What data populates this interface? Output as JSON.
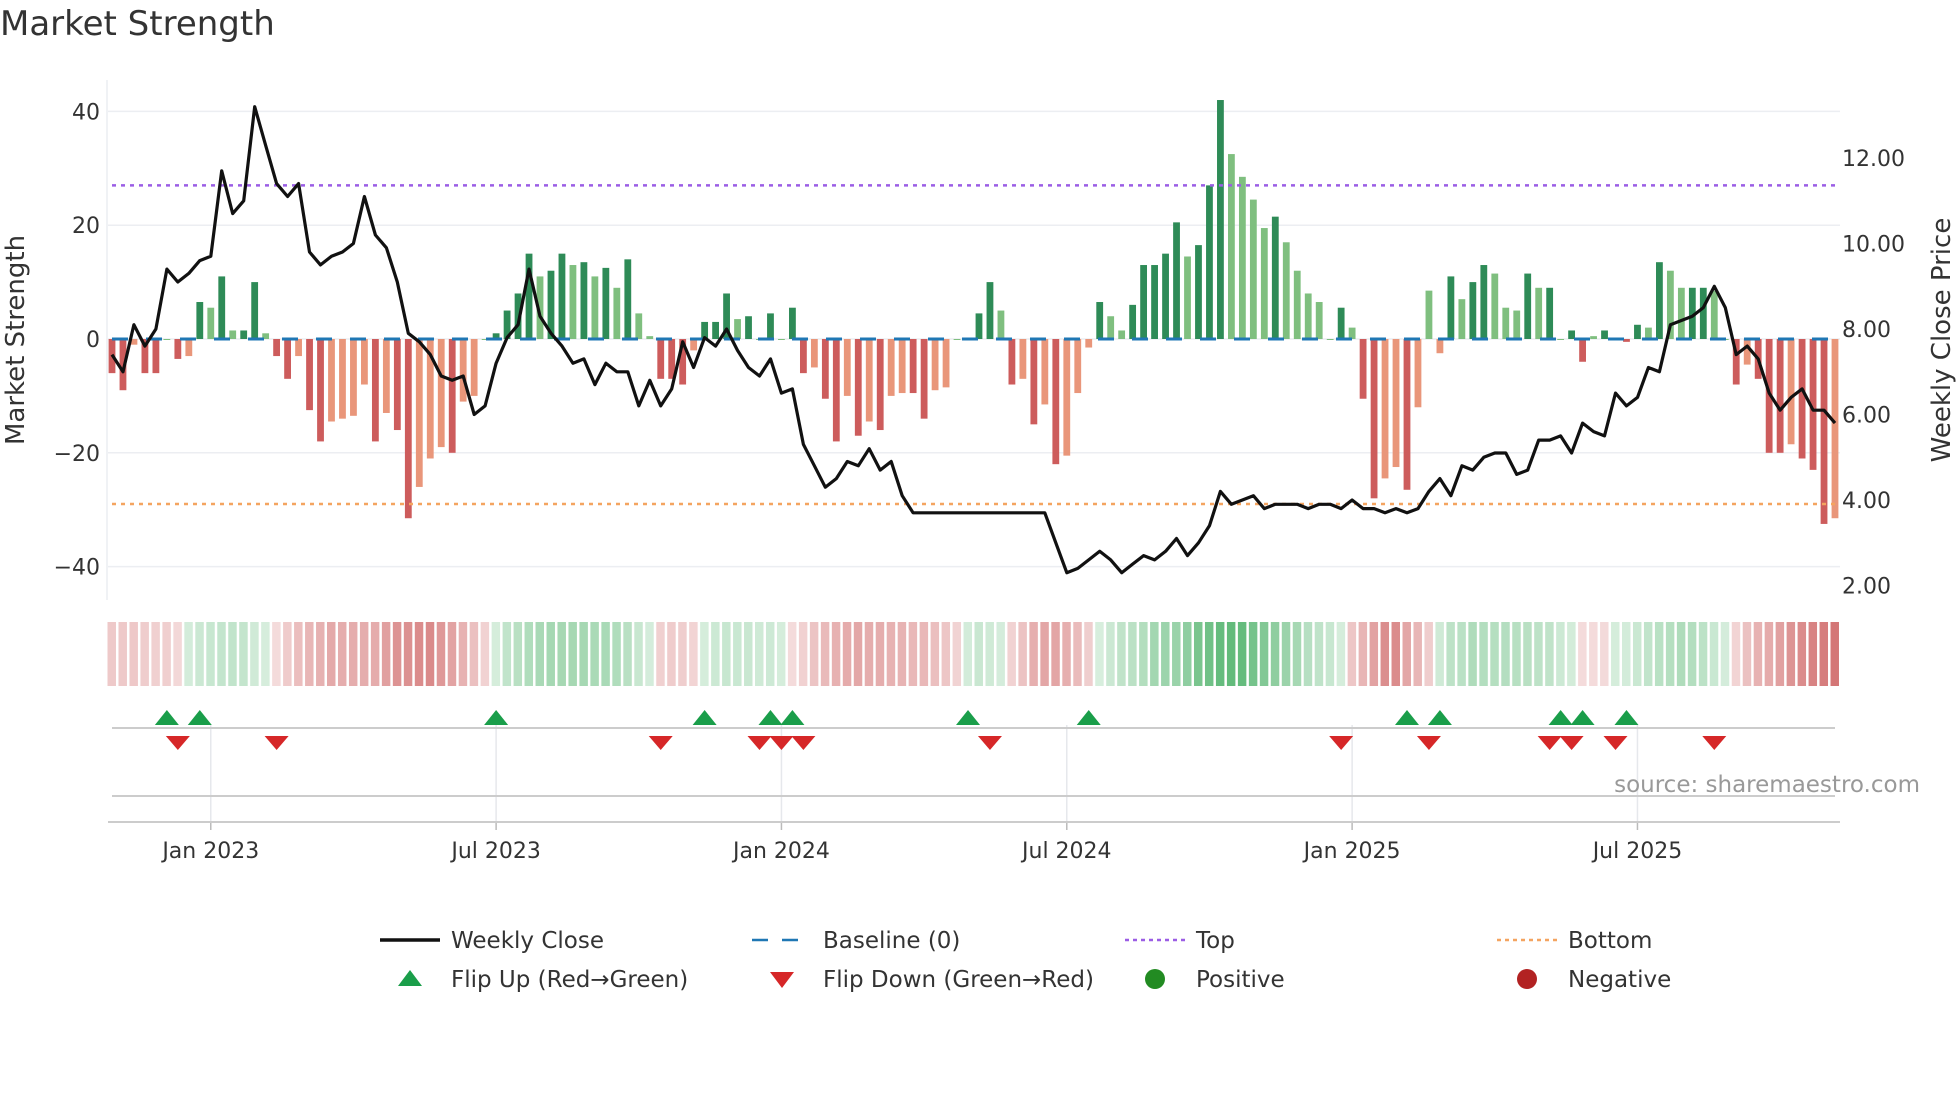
{
  "chart_data": {
    "type": "bar+line",
    "title": "Market Strength",
    "ylabel_left": "Market Strength",
    "ylabel_right": "Weekly Close Price",
    "ylim_left": [
      -42,
      45
    ],
    "ylim_right": [
      1.8,
      13.6
    ],
    "left_ticks": [
      {
        "v": 40,
        "label": "40"
      },
      {
        "v": 20,
        "label": "20"
      },
      {
        "v": 0,
        "label": "0"
      },
      {
        "v": -20,
        "label": "−20"
      },
      {
        "v": -40,
        "label": "−40"
      }
    ],
    "right_ticks": [
      {
        "v": 12,
        "label": "12.00"
      },
      {
        "v": 10,
        "label": "10.00"
      },
      {
        "v": 8,
        "label": "8.00"
      },
      {
        "v": 6,
        "label": "6.00"
      },
      {
        "v": 4,
        "label": "4.00"
      },
      {
        "v": 2,
        "label": "2.00"
      }
    ],
    "x_ticks": [
      {
        "week": 9,
        "label": "Jan 2023"
      },
      {
        "week": 35,
        "label": "Jul 2023"
      },
      {
        "week": 61,
        "label": "Jan 2024"
      },
      {
        "week": 87,
        "label": "Jul 2024"
      },
      {
        "week": 113,
        "label": "Jan 2025"
      },
      {
        "week": 139,
        "label": "Jul 2025"
      }
    ],
    "top_level": 27,
    "bottom_level": -29,
    "baseline": 0,
    "strength": [
      -6,
      -9,
      -1,
      -6,
      -6,
      0,
      -3.5,
      -3,
      6.5,
      5.5,
      11,
      1.5,
      1.5,
      10,
      1,
      -3,
      -7,
      -3,
      -12.5,
      -18,
      -14.5,
      -14,
      -13.5,
      -8,
      -18,
      -13,
      -16,
      -31.5,
      -26,
      -21,
      -19,
      -20,
      -11,
      -10,
      0,
      1,
      5,
      8,
      15,
      11,
      12,
      15,
      13,
      13.5,
      11,
      12.5,
      9,
      14,
      4.5,
      0.5,
      -7,
      -7,
      -8,
      -2,
      3,
      3,
      8,
      3.5,
      4,
      0,
      4.5,
      0,
      5.5,
      -6,
      -5,
      -10.5,
      -18,
      -10,
      -17,
      -14.5,
      -16,
      -10,
      -9.5,
      -9.5,
      -14,
      -9,
      -8.5,
      0,
      0,
      4.5,
      10,
      5,
      -8,
      -7,
      -15,
      -11.5,
      -22,
      -20.5,
      -9.5,
      -1.5,
      6.5,
      4,
      1.5,
      6,
      13,
      13,
      15,
      20.5,
      14.5,
      16.5,
      27,
      42,
      32.5,
      28.5,
      24.5,
      19.5,
      21.5,
      17,
      12,
      8,
      6.5,
      0,
      5.5,
      2,
      -10.5,
      -28,
      -24.5,
      -22.5,
      -26.5,
      -12,
      8.5,
      -2.5,
      11,
      7,
      10,
      13,
      11.5,
      5.5,
      5,
      11.5,
      9,
      9,
      0,
      1.5,
      -4,
      0.5,
      1.5,
      0,
      -0.5,
      2.5,
      2,
      13.5,
      12,
      9,
      9,
      9,
      8.5,
      0,
      -8,
      -4.5,
      -7,
      -20,
      -20,
      -18.5,
      -21,
      -23,
      -32.5,
      -31.5
    ],
    "close": [
      7.4,
      7.0,
      8.1,
      7.6,
      8.0,
      9.4,
      9.1,
      9.3,
      9.6,
      9.7,
      11.7,
      10.7,
      11.0,
      13.2,
      12.3,
      11.4,
      11.1,
      11.4,
      9.8,
      9.5,
      9.7,
      9.8,
      10.0,
      11.1,
      10.2,
      9.9,
      9.1,
      7.9,
      7.7,
      7.4,
      6.9,
      6.8,
      6.9,
      6.0,
      6.2,
      7.2,
      7.8,
      8.1,
      9.4,
      8.3,
      7.9,
      7.6,
      7.2,
      7.3,
      6.7,
      7.2,
      7.0,
      7.0,
      6.2,
      6.8,
      6.2,
      6.6,
      7.7,
      7.1,
      7.8,
      7.6,
      8.0,
      7.5,
      7.1,
      6.9,
      7.3,
      6.5,
      6.6,
      5.3,
      4.8,
      4.3,
      4.5,
      4.9,
      4.8,
      5.2,
      4.7,
      4.9,
      4.1,
      3.7,
      3.7,
      3.7,
      3.7,
      3.7,
      3.7,
      3.7,
      3.7,
      3.7,
      3.7,
      3.7,
      3.7,
      3.7,
      3.0,
      2.3,
      2.4,
      2.6,
      2.8,
      2.6,
      2.3,
      2.5,
      2.7,
      2.6,
      2.8,
      3.1,
      2.7,
      3.0,
      3.4,
      4.2,
      3.9,
      4.0,
      4.1,
      3.8,
      3.9,
      3.9,
      3.9,
      3.8,
      3.9,
      3.9,
      3.8,
      4.0,
      3.8,
      3.8,
      3.7,
      3.8,
      3.7,
      3.8,
      4.2,
      4.5,
      4.1,
      4.8,
      4.7,
      5.0,
      5.1,
      5.1,
      4.6,
      4.7,
      5.4,
      5.4,
      5.5,
      5.1,
      5.8,
      5.6,
      5.5,
      6.5,
      6.2,
      6.4,
      7.1,
      7.0,
      8.1,
      8.2,
      8.3,
      8.5,
      9.0,
      8.5,
      7.4,
      7.6,
      7.3,
      6.5,
      6.1,
      6.4,
      6.6,
      6.1,
      6.1,
      5.8
    ],
    "flip_up_weeks": [
      5,
      8,
      35,
      54,
      60,
      62,
      78,
      89,
      118,
      121,
      132,
      134,
      138
    ],
    "flip_down_weeks": [
      6,
      15,
      50,
      59,
      61,
      63,
      80,
      112,
      120,
      131,
      133,
      137,
      146
    ],
    "colors": {
      "pos_dark": "#2e8b57",
      "pos_light": "#7fbf7f",
      "neg_dark": "#cd5c5c",
      "neg_light": "#e9967a",
      "line": "#111111",
      "baseline": "#1f77b4",
      "top": "#9b5de5",
      "bottom": "#f4a460",
      "flip_up": "#1a9e4a",
      "flip_down": "#d62728",
      "positive": "#228b22",
      "negative": "#b22222"
    },
    "source": "source: sharemaestro.com",
    "legend": [
      {
        "key": "close",
        "label": "Weekly Close"
      },
      {
        "key": "baseline",
        "label": "Baseline (0)"
      },
      {
        "key": "top",
        "label": "Top"
      },
      {
        "key": "bottom",
        "label": "Bottom"
      },
      {
        "key": "flip_up",
        "label": "Flip Up (Red→Green)"
      },
      {
        "key": "flip_down",
        "label": "Flip Down (Green→Red)"
      },
      {
        "key": "positive",
        "label": "Positive"
      },
      {
        "key": "negative",
        "label": "Negative"
      }
    ]
  }
}
